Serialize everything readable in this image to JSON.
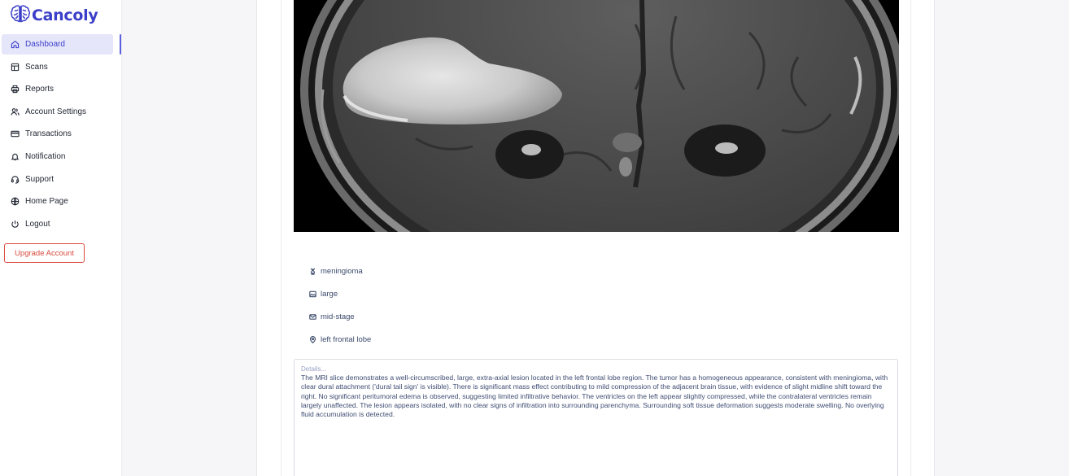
{
  "app": {
    "name": "Cancoly",
    "brand_color": "#3b3ec8",
    "danger_color": "#d84a3c"
  },
  "sidebar": {
    "items": [
      {
        "label": "Dashboard",
        "icon": "home-icon",
        "active": true
      },
      {
        "label": "Scans",
        "icon": "layout-icon",
        "active": false
      },
      {
        "label": "Reports",
        "icon": "printer-icon",
        "active": false
      },
      {
        "label": "Account Settings",
        "icon": "users-icon",
        "active": false
      },
      {
        "label": "Transactions",
        "icon": "credit-card-icon",
        "active": false
      },
      {
        "label": "Notification",
        "icon": "bell-icon",
        "active": false
      },
      {
        "label": "Support",
        "icon": "headset-icon",
        "active": false
      },
      {
        "label": "Home Page",
        "icon": "globe-icon",
        "active": false
      },
      {
        "label": "Logout",
        "icon": "power-icon",
        "active": false
      }
    ],
    "upgrade_label": "Upgrade Account"
  },
  "scan": {
    "attributes": [
      {
        "label": "meningioma",
        "icon": "dna-icon"
      },
      {
        "label": "large",
        "icon": "image-icon"
      },
      {
        "label": "mid-stage",
        "icon": "mail-icon"
      },
      {
        "label": "left frontal lobe",
        "icon": "map-pin-icon"
      }
    ],
    "details_placeholder": "Details...",
    "details_text": "The MRI slice demonstrates a well-circumscribed, large, extra-axial lesion located in the left frontal lobe region. The tumor has a homogeneous appearance, consistent with meningioma, with clear dural attachment ('dural tail sign' is visible). There is significant mass effect contributing to mild compression of the adjacent brain tissue, with evidence of slight midline shift toward the right. No significant peritumoral edema is observed, suggesting limited infiltrative behavior. The ventricles on the left appear slightly compressed, while the contralateral ventricles remain largely unaffected. The lesion appears isolated, with no clear signs of infiltration into surrounding parenchyma. Surrounding soft tissue deformation suggests moderate swelling. No overlying fluid accumulation is detected."
  }
}
